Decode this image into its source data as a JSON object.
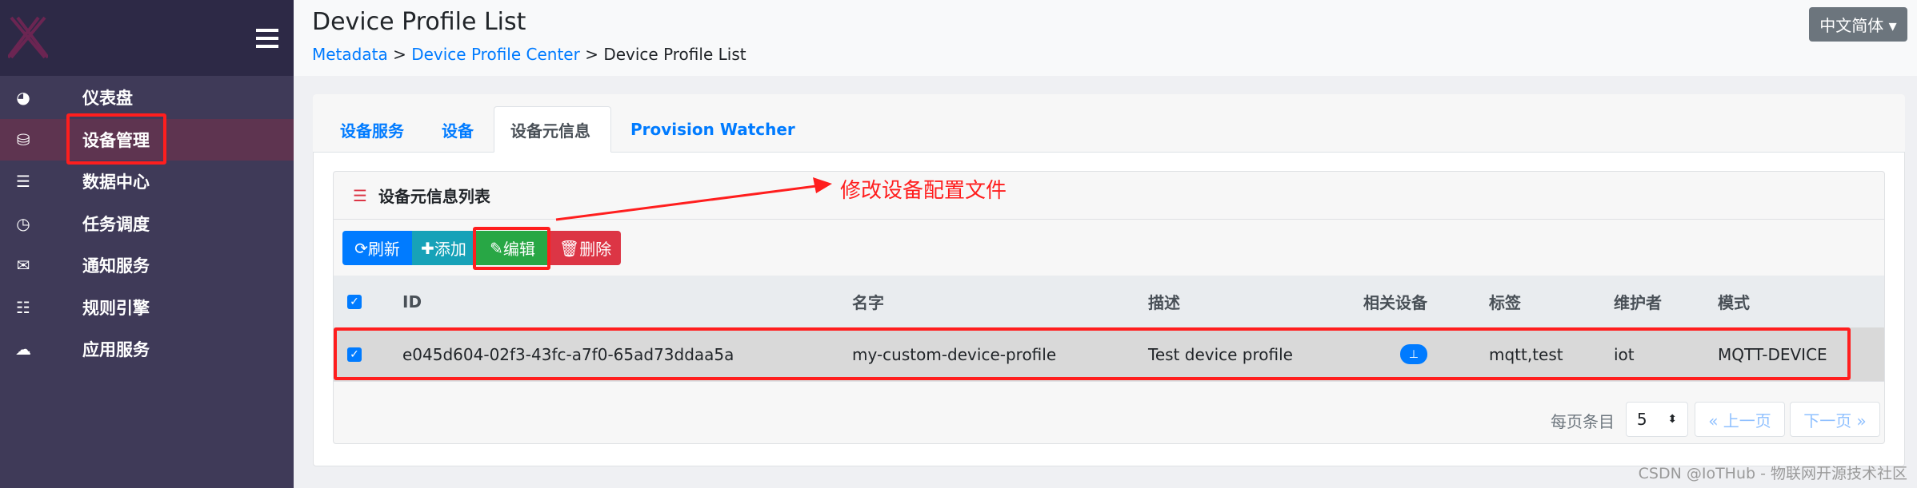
{
  "app": {
    "logo": "X"
  },
  "sidebar": {
    "items": [
      {
        "label": "仪表盘",
        "icon": "tachometer-icon",
        "glyph": "◕"
      },
      {
        "label": "设备管理",
        "icon": "cubes-icon",
        "glyph": "⛁",
        "active": true
      },
      {
        "label": "数据中心",
        "icon": "database-icon",
        "glyph": "☰"
      },
      {
        "label": "任务调度",
        "icon": "clock-icon",
        "glyph": "◷"
      },
      {
        "label": "通知服务",
        "icon": "envelope-icon",
        "glyph": "✉"
      },
      {
        "label": "规则引擎",
        "icon": "sliders-icon",
        "glyph": "☷"
      },
      {
        "label": "应用服务",
        "icon": "cloud-upload-icon",
        "glyph": "☁"
      }
    ]
  },
  "header": {
    "title": "Device Profile List",
    "breadcrumb": [
      "Metadata",
      "Device Profile Center",
      "Device Profile List"
    ],
    "sep": ">",
    "language": "中文简体 ▾"
  },
  "tabs": [
    {
      "label": "设备服务"
    },
    {
      "label": "设备"
    },
    {
      "label": "设备元信息",
      "active": true
    },
    {
      "label": "Provision Watcher"
    }
  ],
  "panel": {
    "title": "设备元信息列表",
    "buttons": {
      "refresh": "刷新",
      "add": "添加",
      "edit": "编辑",
      "delete": "删除"
    }
  },
  "table": {
    "columns": [
      "ID",
      "名字",
      "描述",
      "相关设备",
      "标签",
      "维护者",
      "模式"
    ],
    "rows": [
      {
        "checked": true,
        "id": "e045d604-02f3-43fc-a7f0-65ad73ddaa5a",
        "name": "my-custom-device-profile",
        "description": "Test device profile",
        "labels": "mqtt,test",
        "manufacturer": "iot",
        "model": "MQTT-DEVICE"
      }
    ]
  },
  "pagination": {
    "per_page_label": "每页条目",
    "per_page": "5",
    "prev": "« 上一页",
    "next": "下一页 »"
  },
  "annotation": {
    "text": "修改设备配置文件",
    "color": "#ff1e1e"
  },
  "watermark": "CSDN @IoTHub - 物联网开源技术社区",
  "colors": {
    "primary": "#007bff",
    "info": "#17a2b8",
    "success": "#28a745",
    "danger": "#dc3545",
    "sidebar": "#3f3a58"
  }
}
